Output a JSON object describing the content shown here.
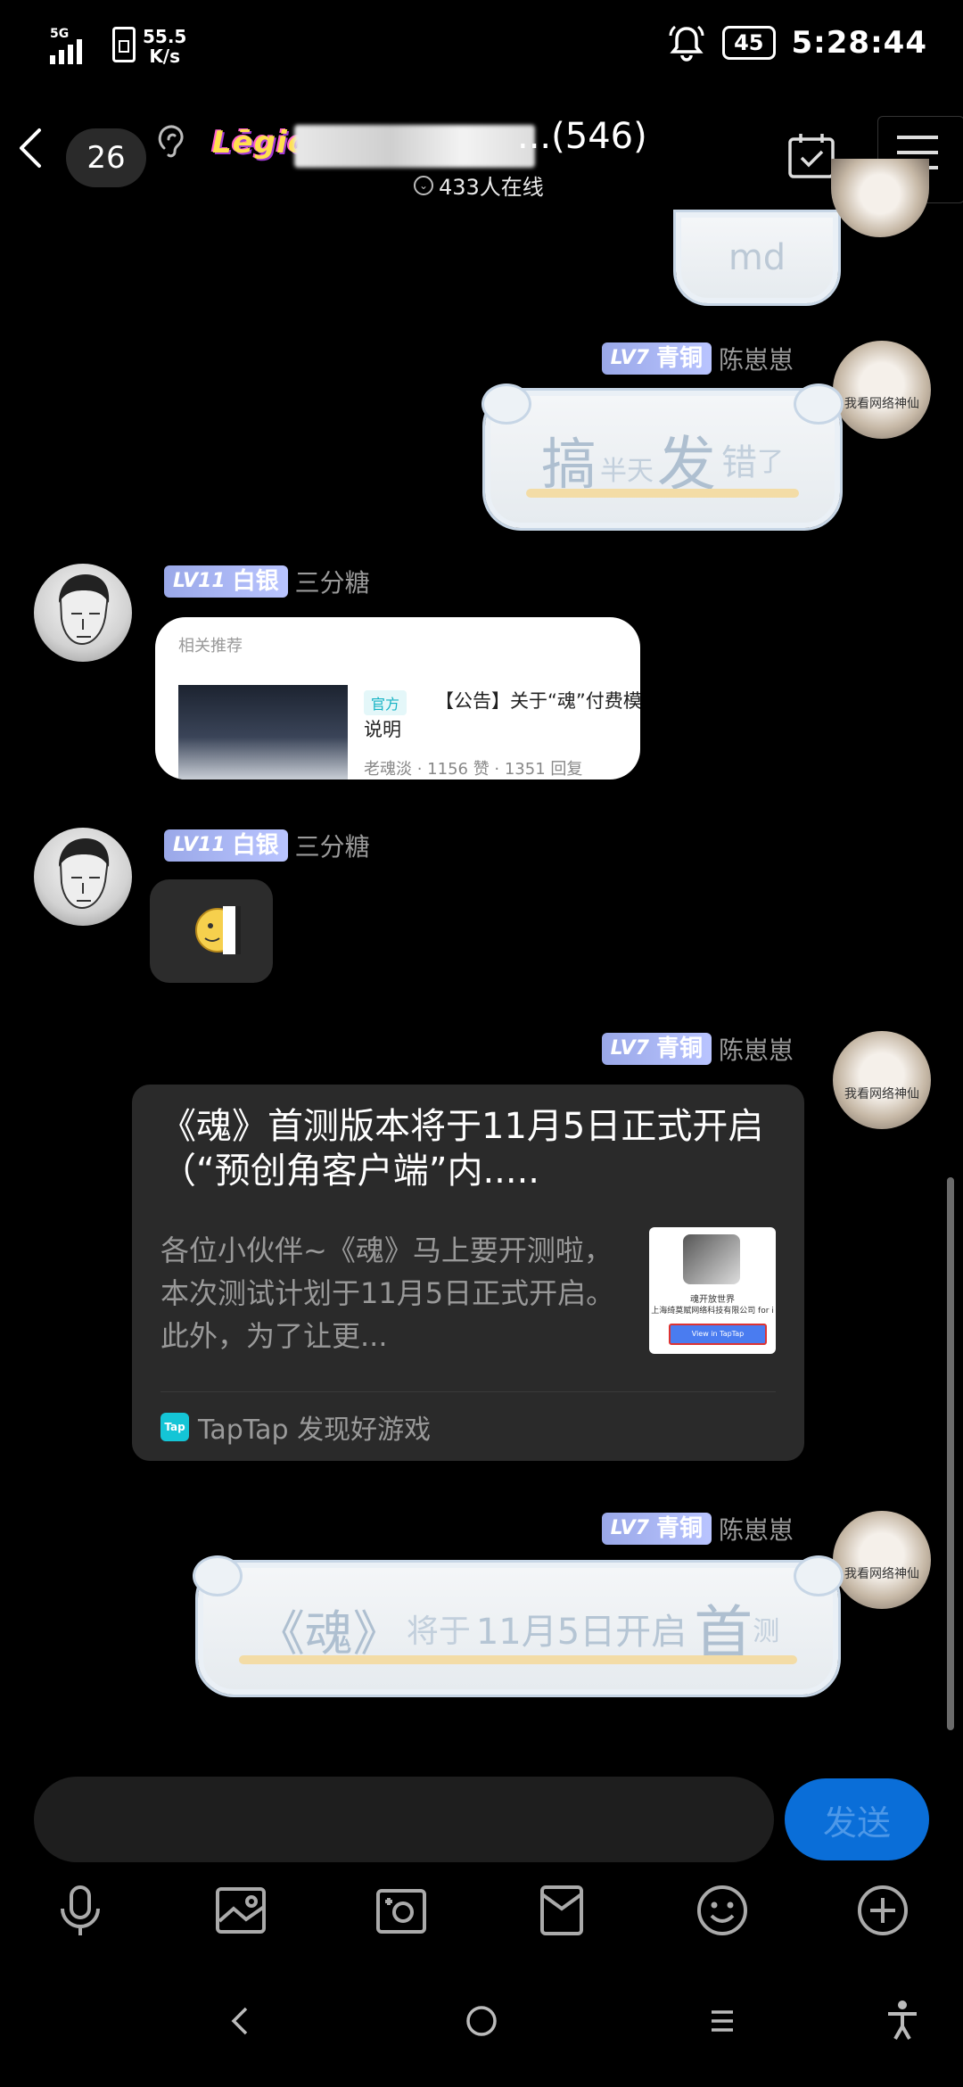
{
  "status_bar": {
    "network": "5G",
    "speed_value": "55.5",
    "speed_unit": "K/s",
    "battery": "45",
    "time": "5:28:44"
  },
  "header": {
    "unread_count": "26",
    "logo_text": "Lēgio",
    "title_partial": "...(546)",
    "online": "433人在线"
  },
  "messages": {
    "sticker_top_text": "md",
    "msg1": {
      "level_lv": "LV7",
      "level_name": "青铜",
      "sender": "陈崽崽",
      "avatar_caption": "我看网络神仙",
      "sticker": [
        "搞",
        "半天",
        "发",
        "错",
        "了"
      ]
    },
    "msg2": {
      "level_lv": "LV11",
      "level_name": "白银",
      "sender": "三分糖",
      "card_label": "相关推荐",
      "card_badge": "官方",
      "card_title": "【公告】关于“魂”付费模式的",
      "card_title_2": "说明",
      "card_meta": "老魂淡 · 1156 赞 · 1351 回复"
    },
    "msg3": {
      "level_lv": "LV11",
      "level_name": "白银",
      "sender": "三分糖",
      "emoji_name": "peeking-moon-face"
    },
    "msg4": {
      "level_lv": "LV7",
      "level_name": "青铜",
      "sender": "陈崽崽",
      "avatar_caption": "我看网络神仙",
      "share_title": "《魂》首测版本将于11月5日正式开启（“预创角客户端”内.....",
      "share_desc": "各位小伙伴~《魂》马上要开测啦，本次测试计划于11月5日正式开启。此外，为了让更...",
      "thumb_line1": "魂开放世界",
      "thumb_line2": "上海绮莫赋网络科技有限公司 for i",
      "thumb_button": "View in TapTap",
      "source_icon": "Tap",
      "source": "TapTap 发现好游戏"
    },
    "msg5": {
      "level_lv": "LV7",
      "level_name": "青铜",
      "sender": "陈崽崽",
      "avatar_caption": "我看网络神仙",
      "sticker": [
        "《魂》",
        "将于",
        "11月5日开启",
        "首",
        "测"
      ]
    }
  },
  "input": {
    "placeholder": "",
    "send_label": "发送"
  },
  "colors": {
    "send_button": "#0a6ed8",
    "level_badge": "#9aa8e8",
    "tap_brand": "#14c5d6"
  }
}
